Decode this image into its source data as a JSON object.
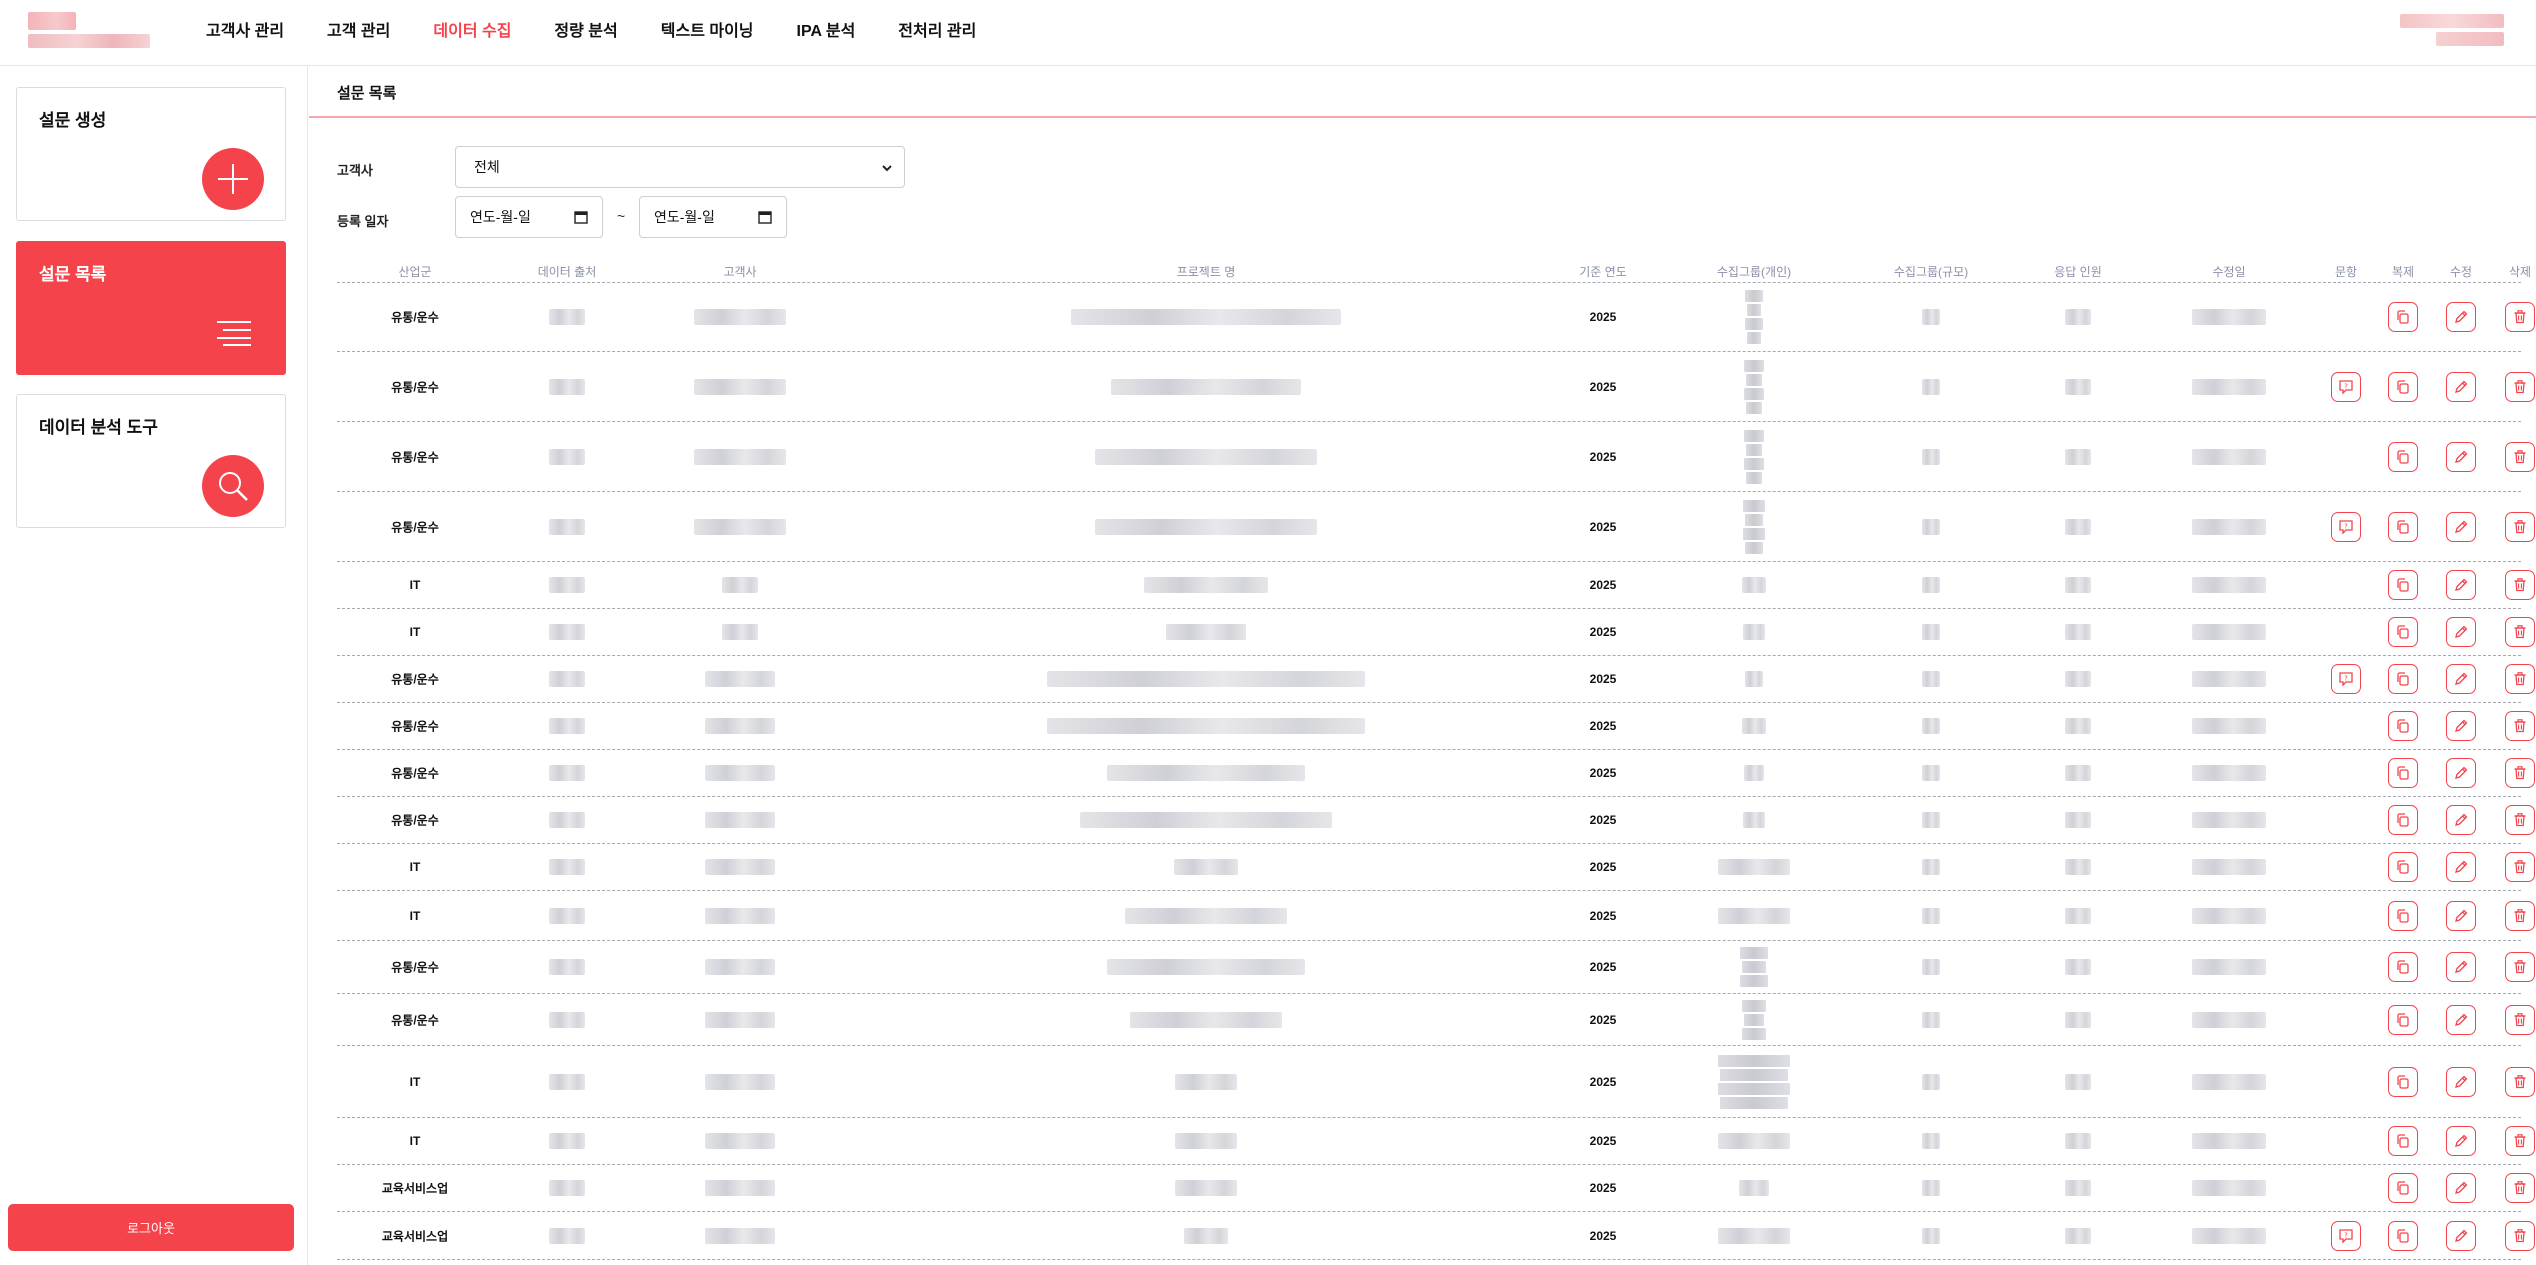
{
  "nav": {
    "items": [
      "고객사 관리",
      "고객 관리",
      "데이터 수집",
      "정량 분석",
      "텍스트 마이닝",
      "IPA 분석",
      "전처리 관리"
    ],
    "active_index": 2
  },
  "sidebar": {
    "create_label": "설문 생성",
    "list_label": "설문 목록",
    "tools_label": "데이터 분석 도구",
    "logout_label": "로그아웃"
  },
  "main": {
    "title": "설문 목록",
    "client_label": "고객사",
    "client_value": "전체",
    "date_label": "등록 일자",
    "date_from_placeholder": "연도-월-일",
    "date_to_placeholder": "연도-월-일",
    "date_separator": "~"
  },
  "table": {
    "headers": [
      "산업군",
      "데이터 출처",
      "고객사",
      "프로젝트 명",
      "기준 연도",
      "수집그룹(개인)",
      "수집그룹(규모)",
      "응답 인원",
      "수정일",
      "문항",
      "복제",
      "수정",
      "삭제"
    ],
    "rows": [
      {
        "industry": "유통/운수",
        "year": "2025",
        "has_question": false
      },
      {
        "industry": "유통/운수",
        "year": "2025",
        "has_question": true
      },
      {
        "industry": "유통/운수",
        "year": "2025",
        "has_question": false
      },
      {
        "industry": "유통/운수",
        "year": "2025",
        "has_question": true
      },
      {
        "industry": "IT",
        "year": "2025",
        "has_question": false
      },
      {
        "industry": "IT",
        "year": "2025",
        "has_question": false
      },
      {
        "industry": "유통/운수",
        "year": "2025",
        "has_question": true
      },
      {
        "industry": "유통/운수",
        "year": "2025",
        "has_question": false
      },
      {
        "industry": "유통/운수",
        "year": "2025",
        "has_question": false
      },
      {
        "industry": "유통/운수",
        "year": "2025",
        "has_question": false
      },
      {
        "industry": "IT",
        "year": "2025",
        "has_question": false
      },
      {
        "industry": "IT",
        "year": "2025",
        "has_question": false
      },
      {
        "industry": "유통/운수",
        "year": "2025",
        "has_question": false
      },
      {
        "industry": "유통/운수",
        "year": "2025",
        "has_question": false
      },
      {
        "industry": "IT",
        "year": "2025",
        "has_question": false
      },
      {
        "industry": "IT",
        "year": "2025",
        "has_question": false
      },
      {
        "industry": "교육서비스업",
        "year": "2025",
        "has_question": false
      },
      {
        "industry": "교육서비스업",
        "year": "2025",
        "has_question": true
      }
    ]
  },
  "colors": {
    "accent": "#f4434b",
    "header_text": "#8a8fa8"
  },
  "icons": {
    "question": "message-icon",
    "copy": "copy-icon",
    "edit": "pencil-icon",
    "delete": "trash-icon"
  }
}
